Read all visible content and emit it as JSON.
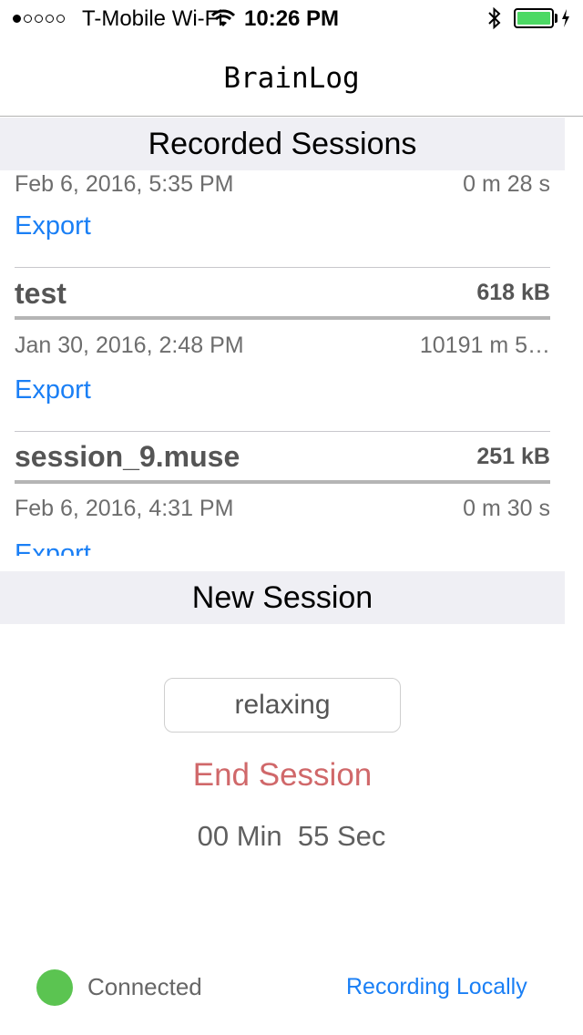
{
  "status_bar": {
    "carrier": "T-Mobile Wi-Fi",
    "time": "10:26 PM",
    "signal_bars": 1,
    "battery_level": 1.0,
    "battery_color": "#4cd964"
  },
  "nav": {
    "title": "BrainLog"
  },
  "recorded_sessions": {
    "header": "Recorded Sessions",
    "partial_top": {
      "date": "Feb 6, 2016, 5:35 PM",
      "duration": "0 m 28 s",
      "export_label": "Export"
    },
    "items": [
      {
        "name": "test",
        "size": "618 kB",
        "date": "Jan 30, 2016, 2:48 PM",
        "duration": "10191 m 5…",
        "export_label": "Export"
      },
      {
        "name": "session_9.muse",
        "size": "251 kB",
        "date": "Feb 6, 2016, 4:31 PM",
        "duration": "0 m 30 s",
        "export_label": "Export"
      }
    ]
  },
  "new_session": {
    "header": "New Session",
    "label_value": "relaxing",
    "end_button": "End Session",
    "timer": "00 Min  55 Sec"
  },
  "footer": {
    "status": "Connected",
    "status_color": "#5bc451",
    "recording": "Recording Locally"
  },
  "colors": {
    "accent": "#1a7ff5",
    "destructive": "#d0686a",
    "header_bg": "#efeff4"
  }
}
